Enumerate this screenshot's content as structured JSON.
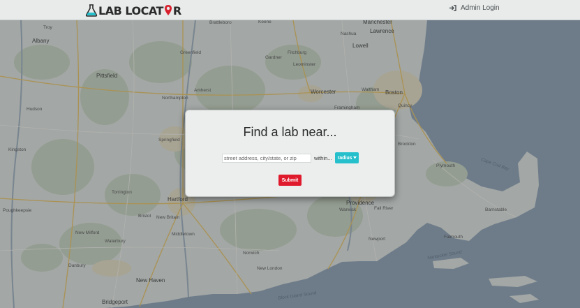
{
  "header": {
    "brand_part1": "LAB LOCAT",
    "brand_part2": "R",
    "admin_login": "Admin Login",
    "icons": {
      "brand": "flask-icon",
      "login": "sign-in-icon"
    }
  },
  "map": {
    "labels": [
      {
        "text": "Troy"
      },
      {
        "text": "Albany"
      },
      {
        "text": "Brattleboro"
      },
      {
        "text": "Keene"
      },
      {
        "text": "Manchester"
      },
      {
        "text": "Nashua"
      },
      {
        "text": "Lowell"
      },
      {
        "text": "Lawrence"
      },
      {
        "text": "Greenfield"
      },
      {
        "text": "Fitchburg"
      },
      {
        "text": "Leominster"
      },
      {
        "text": "Gardner"
      },
      {
        "text": "Pittsfield"
      },
      {
        "text": "Northampton"
      },
      {
        "text": "Amherst"
      },
      {
        "text": "Worcester"
      },
      {
        "text": "Framingham"
      },
      {
        "text": "Waltham"
      },
      {
        "text": "Boston"
      },
      {
        "text": "Quincy"
      },
      {
        "text": "Springfield"
      },
      {
        "text": "Hartford"
      },
      {
        "text": "Torrington"
      },
      {
        "text": "Bristol"
      },
      {
        "text": "New Britain"
      },
      {
        "text": "Middletown"
      },
      {
        "text": "Danbury"
      },
      {
        "text": "Waterbury"
      },
      {
        "text": "Norwich"
      },
      {
        "text": "New London"
      },
      {
        "text": "Providence"
      },
      {
        "text": "Warwick"
      },
      {
        "text": "Fall River"
      },
      {
        "text": "Plymouth"
      },
      {
        "text": "Brockton"
      },
      {
        "text": "Barnstable"
      },
      {
        "text": "Falmouth"
      },
      {
        "text": "Newport"
      },
      {
        "text": "Poughkeepsie"
      },
      {
        "text": "New Milford"
      },
      {
        "text": "New Haven"
      },
      {
        "text": "Bridgeport"
      },
      {
        "text": "Hudson"
      },
      {
        "text": "Kingston"
      },
      {
        "text": "Cape Cod Bay"
      },
      {
        "text": "Block Island Sound"
      },
      {
        "text": "Nantucket Sound"
      }
    ]
  },
  "modal": {
    "title": "Find a lab near...",
    "search_placeholder": "street address, city/state, or zip",
    "search_value": "",
    "within_label": "within...",
    "radius_label": "radius",
    "submit_label": "Submit"
  },
  "colors": {
    "accent_teal": "#26c0cc",
    "submit_red": "#e01a2d",
    "brand_red": "#d9212e",
    "header_bg": "#e8ebea",
    "water": "#7f93a9",
    "land": "#d9ddd7"
  }
}
